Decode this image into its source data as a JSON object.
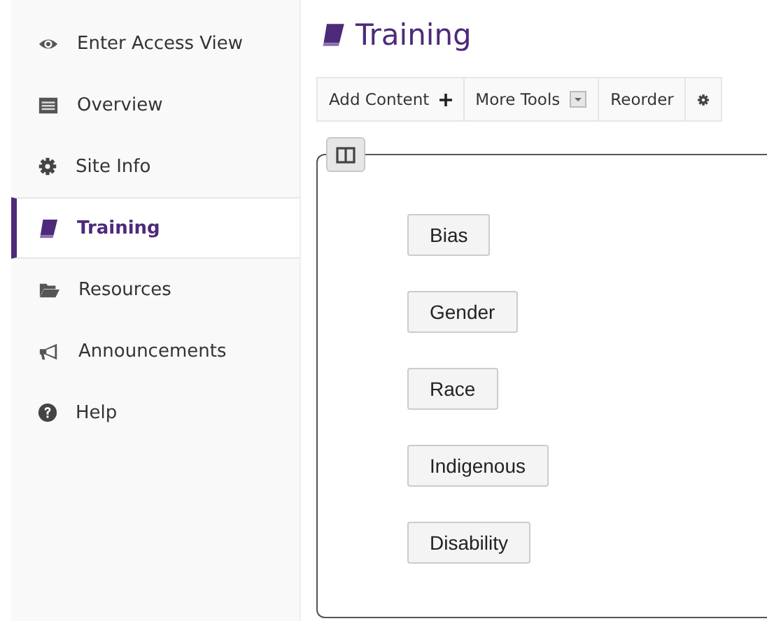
{
  "sidebar": {
    "items": [
      {
        "label": "Enter Access View",
        "kind": "eye",
        "selected": false
      },
      {
        "label": "Overview",
        "kind": "list",
        "selected": false
      },
      {
        "label": "Site Info",
        "kind": "gear",
        "selected": false
      },
      {
        "label": "Training",
        "kind": "book",
        "selected": true
      },
      {
        "label": "Resources",
        "kind": "folder",
        "selected": false
      },
      {
        "label": "Announcements",
        "kind": "megaphone",
        "selected": false
      },
      {
        "label": "Help",
        "kind": "help",
        "selected": false
      }
    ]
  },
  "page": {
    "title": "Training"
  },
  "toolbar": [
    {
      "label": "Add Content",
      "kind": "add"
    },
    {
      "label": "More Tools",
      "kind": "menu"
    },
    {
      "label": "Reorder",
      "kind": "plain"
    },
    {
      "kind": "settings"
    }
  ],
  "buttons": [
    "Bias",
    "Gender",
    "Race",
    "Indigenous",
    "Disability"
  ]
}
